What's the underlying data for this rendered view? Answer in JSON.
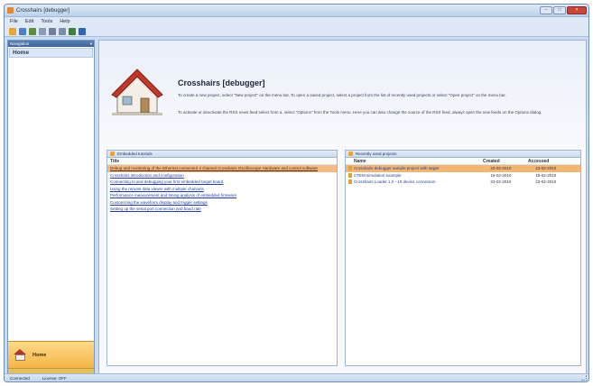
{
  "window": {
    "title": "Crosshairs [debugger]",
    "close_glyph": "×",
    "min_glyph": "–",
    "max_glyph": "□"
  },
  "menu": [
    "File",
    "Edit",
    "Tools",
    "Help"
  ],
  "toolbar_icons": [
    "open-icon",
    "save-icon",
    "save-all-icon",
    "refresh-icon",
    "settings-icon",
    "grid-icon",
    "play-icon",
    "help-icon"
  ],
  "sidebar": {
    "header": "Navigation",
    "pin_glyph": "▾",
    "items": [
      {
        "label": "Home"
      }
    ],
    "nav_button": "Home"
  },
  "hero": {
    "title": "Crosshairs [debugger]",
    "p1": "To create a new project, select \"New project\" on the menu bar. To open a saved project, select a project from the list of recently used projects or select \"Open project\" on the menu bar.",
    "p2": "To activate or deactivate the RSS news feed select from a, select \"Options\" from the Tools menu. Here you can also change the source of the RSS feed, always open the new feeds on the Options dialog."
  },
  "tutorials": {
    "header": "Embedded tutorials",
    "column": "Title",
    "rows": [
      "Debug and monitoring of the Ethernet connected 4 channel Crosshairs Oscilloscope Hardware and control software",
      "Crosshairs introduction and configuration",
      "Connecting to and debugging your first embedded target board",
      "Using the remote data viewer with multiple channels",
      "Performance measurement and timing analysis of embedded firmware",
      "Customizing the waveform display and trigger settings",
      "Setting up the serial port connection and baud rate"
    ]
  },
  "recent": {
    "header": "Recently used projects",
    "columns": {
      "name": "Name",
      "created": "Created",
      "accessed": "Accessed"
    },
    "rows": [
      {
        "name": "Crosshairs debugger sample project with target",
        "created": "23-02-2010",
        "accessed": "23-02-2010"
      },
      {
        "name": "CTEM simulation example",
        "created": "18-02-2010",
        "accessed": "18-02-2010"
      },
      {
        "name": "Crosshairs Loader 1.0 - 10 device connection",
        "created": "23-02-2010",
        "accessed": "23-02-2010"
      }
    ]
  },
  "status": {
    "left": "Connected",
    "mid": "License: OFF"
  }
}
